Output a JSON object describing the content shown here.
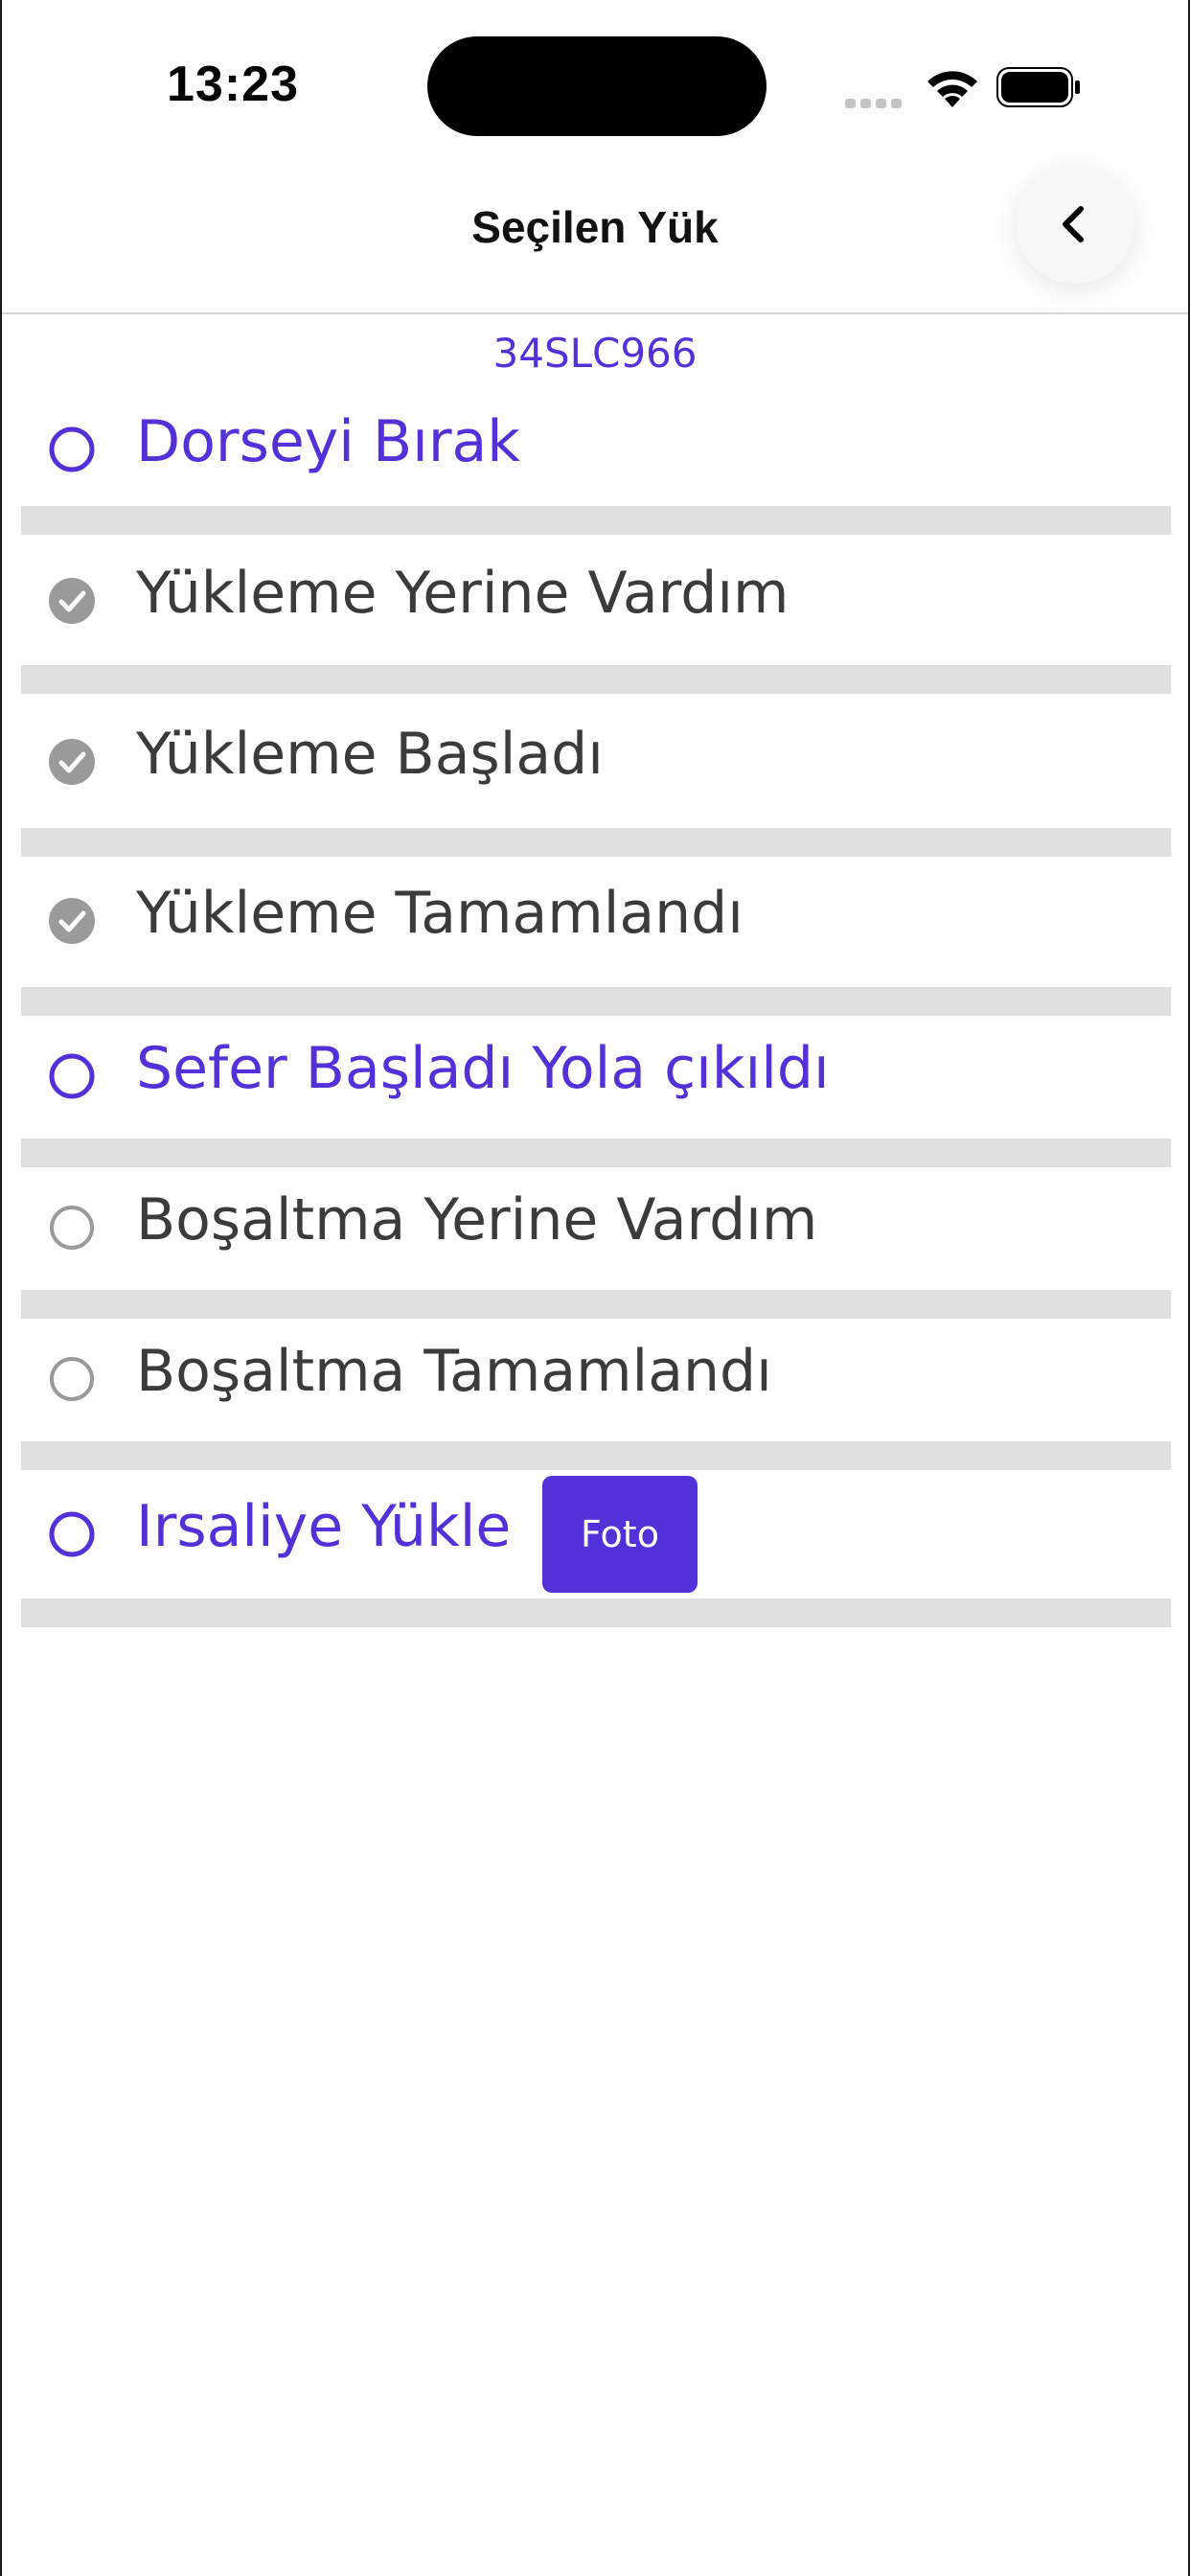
{
  "status_bar": {
    "time": "13:23"
  },
  "header": {
    "title": "Seçilen Yük"
  },
  "plate": "34SLC966",
  "colors": {
    "accent": "#5330d8",
    "done": "#9a9a9a",
    "separator": "#e0e0e0"
  },
  "steps": [
    {
      "label": "Dorseyi Bırak",
      "state": "active",
      "icon": "circle-outline-icon"
    },
    {
      "label": "Yükleme Yerine Vardım",
      "state": "done",
      "icon": "check-circle-icon"
    },
    {
      "label": "Yükleme Başladı",
      "state": "done",
      "icon": "check-circle-icon"
    },
    {
      "label": "Yükleme Tamamlandı",
      "state": "done",
      "icon": "check-circle-icon"
    },
    {
      "label": "Sefer Başladı Yola çıkıldı",
      "state": "active",
      "icon": "circle-outline-icon"
    },
    {
      "label": "Boşaltma Yerine Vardım",
      "state": "pending",
      "icon": "circle-outline-icon"
    },
    {
      "label": "Boşaltma Tamamlandı",
      "state": "pending",
      "icon": "circle-outline-icon"
    },
    {
      "label": "Irsaliye Yükle",
      "state": "active",
      "icon": "circle-outline-icon",
      "button": "Foto"
    }
  ]
}
